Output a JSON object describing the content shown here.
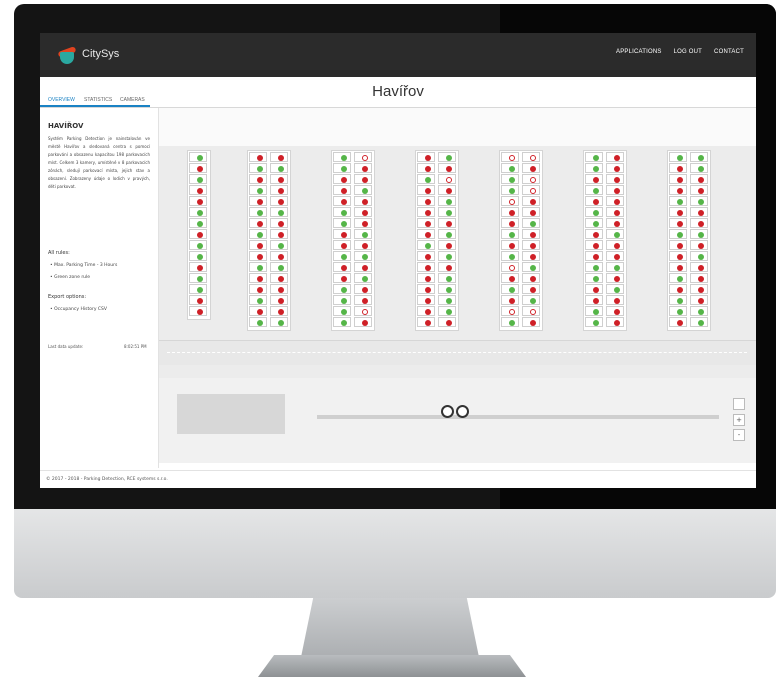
{
  "header": {
    "logo_text": "CitySys",
    "nav": [
      "APPLICATIONS",
      "LOG OUT",
      "CONTACT"
    ]
  },
  "tabs": [
    "OVERVIEW",
    "STATISTICS",
    "CAMERAS"
  ],
  "page_title": "Havířov",
  "sidebar": {
    "heading": "HAVÍŘOV",
    "description": "Systém Parking Detection je nainstalován ve městě Havířov a sledovaná centra s pomocí parkování a obsazenu kapacitou 198 parkovacích míst. Celkem 3 kamery, umístěné v 8 parkovacích zónách, sledují parkovací místa, jejich stav a obsazení. Zobrazeny údaje o lodich v pravých, děti parkovat.",
    "all_rules_label": "All rules:",
    "rules": [
      "Max. Parking Time - 3 Hours",
      "Green zone rule"
    ],
    "export_label": "Export options:",
    "exports": [
      "Occupancy History CSV"
    ],
    "last_update_label": "Last data update:",
    "last_update_value": "8:02:51 PM"
  },
  "map": {
    "zoom_plus": "+",
    "zoom_minus": "-",
    "colors": {
      "free": "#55b548",
      "occupied": "#cf2027"
    },
    "columns": [
      {
        "rows": 15,
        "pattern": "fofooffoffoffoo"
      },
      {
        "rows": 15,
        "pattern": "ooffoofoooffoofoofooffoooofo"
      },
      {
        "rows": 15,
        "pattern": "frfoooofoofofoofooffoooffofo"
      },
      {
        "rows": 15,
        "pattern": "ofoofrooofofoooffoofooofofof"
      },
      {
        "rows": 15,
        "pattern": "rrfofrfrrooooffoooforfoofoof"
      },
      {
        "rows": 15,
        "pattern": "fofooofooofofoofoooofffoofoo"
      },
      {
        "rows": 15,
        "pattern": "ffofooooffooooffooofoofooofo"
      }
    ]
  },
  "footer": "© 2017 - 2018 - Parking Detection, RCE systems s.r.o."
}
